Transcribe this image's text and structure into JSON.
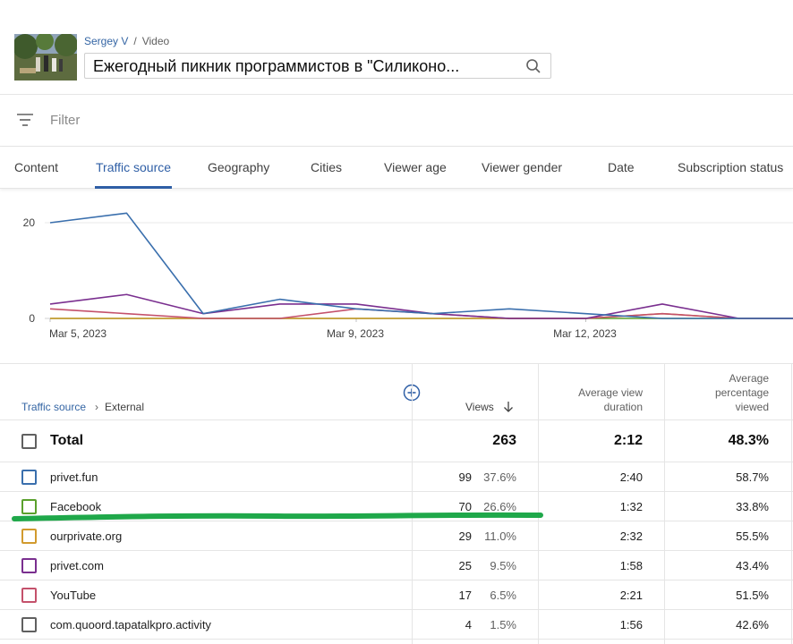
{
  "header": {
    "channel_name": "Sergey V",
    "separator": "/",
    "section": "Video",
    "video_title": "Ежегодный пикник программистов в \"Силиконо..."
  },
  "filter": {
    "label": "Filter"
  },
  "tabs": [
    {
      "label": "Content",
      "active": false
    },
    {
      "label": "Traffic source",
      "active": true
    },
    {
      "label": "Geography",
      "active": false
    },
    {
      "label": "Cities",
      "active": false
    },
    {
      "label": "Viewer age",
      "active": false
    },
    {
      "label": "Viewer gender",
      "active": false
    },
    {
      "label": "Date",
      "active": false
    },
    {
      "label": "Subscription status",
      "active": false
    }
  ],
  "chart_data": {
    "type": "line",
    "x": [
      "Mar 5",
      "Mar 6",
      "Mar 7",
      "Mar 8",
      "Mar 9",
      "Mar 10",
      "Mar 11",
      "Mar 12",
      "Mar 13",
      "Mar 14",
      "Mar 15"
    ],
    "x_tick_labels": [
      "Mar 5, 2023",
      "Mar 9, 2023",
      "Mar 12, 2023"
    ],
    "y_tick_labels": [
      "20",
      "0"
    ],
    "ylim": [
      0,
      22
    ],
    "grid": true,
    "series": [
      {
        "color": "#3a6fad",
        "values": [
          20,
          22,
          1,
          4,
          2,
          1,
          2,
          1,
          0,
          0,
          0
        ]
      },
      {
        "color": "#7a2f8f",
        "values": [
          3,
          5,
          1,
          3,
          3,
          1,
          0,
          0,
          3,
          0,
          0
        ]
      },
      {
        "color": "#c4516b",
        "values": [
          2,
          1,
          0,
          0,
          2,
          1,
          0,
          0,
          1,
          0,
          0
        ]
      },
      {
        "color": "#d19a2e",
        "values": [
          0,
          0,
          0,
          0,
          0,
          0,
          0,
          0,
          1,
          0,
          0
        ]
      },
      {
        "color": "#5aa02c",
        "values": [
          0,
          0,
          0,
          0,
          0,
          0,
          0,
          0,
          0,
          0,
          0
        ]
      }
    ]
  },
  "table": {
    "breadcrumb_source": "Traffic source",
    "breadcrumb_arrow": "›",
    "breadcrumb_current": "External",
    "col_views": "Views",
    "col_avg_duration_line1": "Average view",
    "col_avg_duration_line2": "duration",
    "col_avg_pct_line1": "Average",
    "col_avg_pct_line2": "percentage",
    "col_avg_pct_line3": "viewed",
    "total": {
      "label": "Total",
      "views": "263",
      "duration": "2:12",
      "pct_viewed": "48.3%"
    },
    "rows": [
      {
        "label": "privet.fun",
        "views": "99",
        "share": "37.6%",
        "duration": "2:40",
        "pct_viewed": "58.7%",
        "color": "#3a6fad"
      },
      {
        "label": "Facebook",
        "views": "70",
        "share": "26.6%",
        "duration": "1:32",
        "pct_viewed": "33.8%",
        "color": "#5aa02c"
      },
      {
        "label": "ourprivate.org",
        "views": "29",
        "share": "11.0%",
        "duration": "2:32",
        "pct_viewed": "55.5%",
        "color": "#d19a2e"
      },
      {
        "label": "privet.com",
        "views": "25",
        "share": "9.5%",
        "duration": "1:58",
        "pct_viewed": "43.4%",
        "color": "#7a2f8f"
      },
      {
        "label": "YouTube",
        "views": "17",
        "share": "6.5%",
        "duration": "2:21",
        "pct_viewed": "51.5%",
        "color": "#c4516b"
      },
      {
        "label": "com.quoord.tapatalkpro.activity",
        "views": "4",
        "share": "1.5%",
        "duration": "1:56",
        "pct_viewed": "42.6%",
        "color": "#606060"
      }
    ]
  },
  "colors": {
    "accent": "#2f5fa6",
    "link": "#3465a4",
    "highlight_stroke": "#1fa84a"
  }
}
